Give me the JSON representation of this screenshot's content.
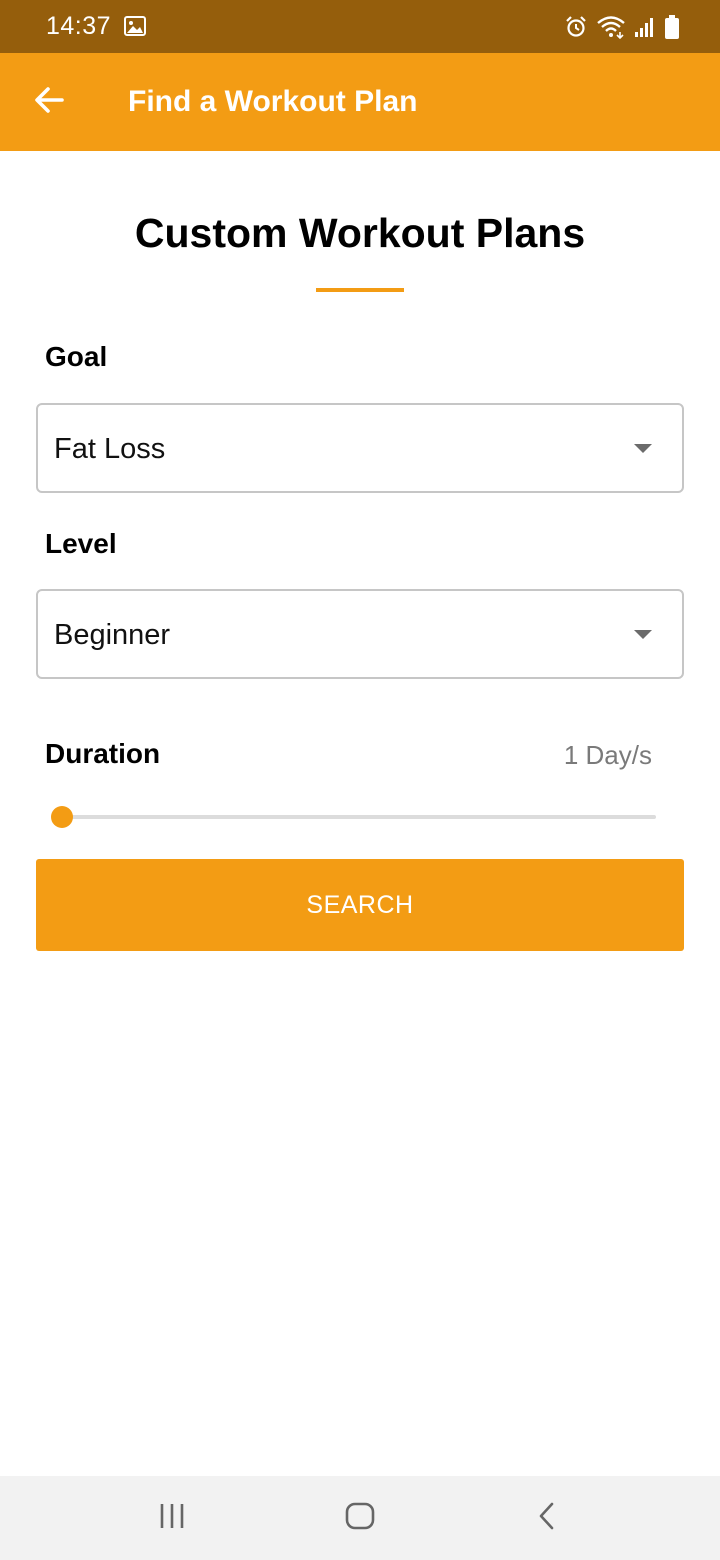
{
  "status_bar": {
    "time": "14:37"
  },
  "app_bar": {
    "title": "Find a Workout Plan"
  },
  "main": {
    "title": "Custom Workout Plans",
    "goal": {
      "label": "Goal",
      "selected": "Fat Loss"
    },
    "level": {
      "label": "Level",
      "selected": "Beginner"
    },
    "duration": {
      "label": "Duration",
      "value_text": "1 Day/s",
      "slider_fraction": 0.0
    },
    "search_button": "SEARCH"
  },
  "colors": {
    "status_bar": "#955e0c",
    "accent": "#f39c14",
    "nav_bar": "#f2f2f2"
  },
  "icons": {
    "back": "arrow-left-icon",
    "status": [
      "gallery-icon",
      "alarm-icon",
      "wifi-icon",
      "signal-icon",
      "battery-icon"
    ],
    "nav": [
      "recent-apps-icon",
      "home-icon",
      "back-nav-icon"
    ]
  }
}
